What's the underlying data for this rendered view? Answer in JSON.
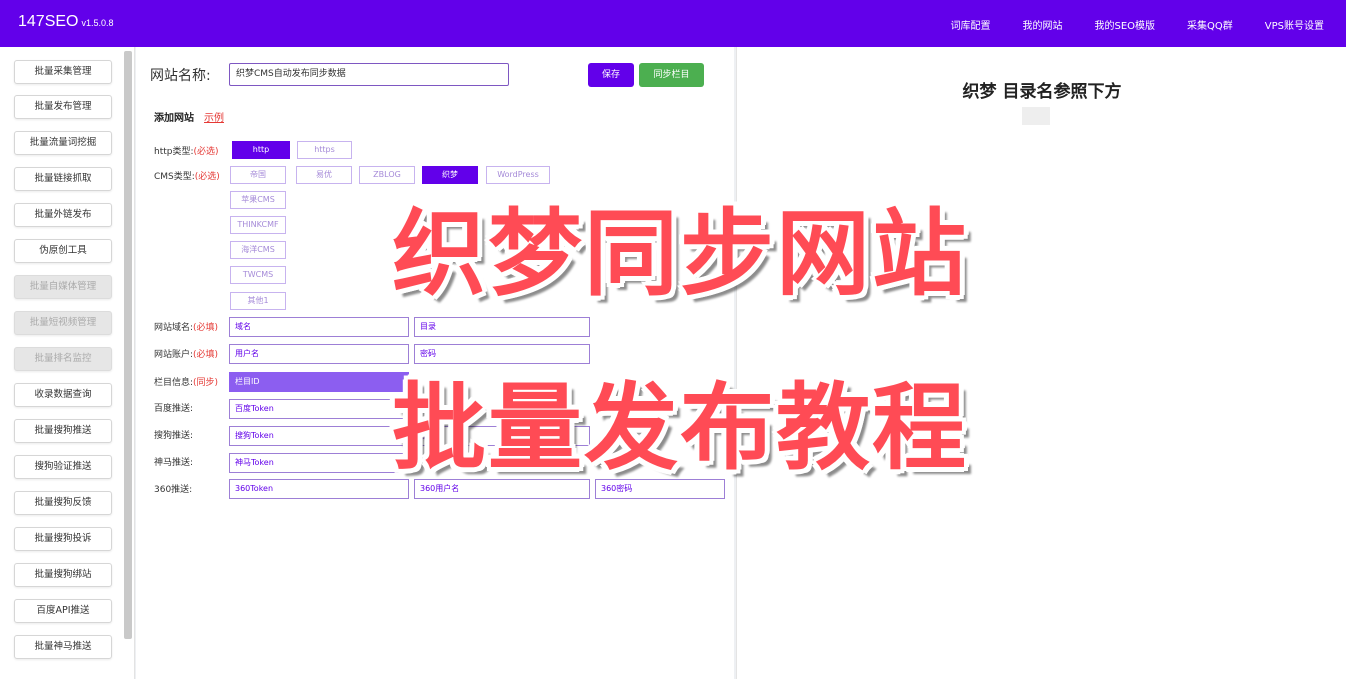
{
  "app": {
    "brand": "147SEO",
    "version": "v1.5.0.8"
  },
  "topnav": [
    "词库配置",
    "我的网站",
    "我的SEO模版",
    "采集QQ群",
    "VPS账号设置"
  ],
  "sidebar": [
    {
      "label": "批量采集管理",
      "disabled": false
    },
    {
      "label": "批量发布管理",
      "disabled": false
    },
    {
      "label": "批量流量词挖掘",
      "disabled": false
    },
    {
      "label": "批量链接抓取",
      "disabled": false
    },
    {
      "label": "批量外链发布",
      "disabled": false
    },
    {
      "label": "伪原创工具",
      "disabled": false
    },
    {
      "label": "批量自媒体管理",
      "disabled": true
    },
    {
      "label": "批量短视频管理",
      "disabled": true
    },
    {
      "label": "批量排名监控",
      "disabled": true
    },
    {
      "label": "收录数据查询",
      "disabled": false
    },
    {
      "label": "批量搜狗推送",
      "disabled": false
    },
    {
      "label": "搜狗验证推送",
      "disabled": false
    },
    {
      "label": "批量搜狗反馈",
      "disabled": false
    },
    {
      "label": "批量搜狗投诉",
      "disabled": false
    },
    {
      "label": "批量搜狗绑站",
      "disabled": false
    },
    {
      "label": "百度API推送",
      "disabled": false
    },
    {
      "label": "批量神马推送",
      "disabled": false
    }
  ],
  "form": {
    "site_name_label": "网站名称:",
    "site_name_value": "织梦CMS自动发布同步数据",
    "save_label": "保存",
    "sync_label": "同步栏目",
    "add_site_title": "添加网站",
    "add_site_example": "示例",
    "http_type_label": "http类型:",
    "required_mark": "(必选)",
    "http_options": [
      {
        "label": "http",
        "selected": true
      },
      {
        "label": "https",
        "selected": false
      }
    ],
    "cms_type_label": "CMS类型:",
    "cms_row1": [
      {
        "label": "帝国",
        "selected": false
      },
      {
        "label": "易优",
        "selected": false
      },
      {
        "label": "ZBLOG",
        "selected": false
      },
      {
        "label": "织梦",
        "selected": true
      },
      {
        "label": "WordPress",
        "selected": false
      }
    ],
    "cms_col": [
      "苹果CMS",
      "THINKCMF",
      "海洋CMS",
      "TWCMS",
      "其他1"
    ],
    "domain_label": "网站域名:",
    "domain_req": "(必填)",
    "domain_placeholder": "域名",
    "dir_placeholder": "目录",
    "account_label": "网站账户:",
    "account_req": "(必填)",
    "user_placeholder": "用户名",
    "pass_placeholder": "密码",
    "column_label": "栏目信息:",
    "column_req": "(同步)",
    "column_id": "栏目ID",
    "baidu_label": "百度推送:",
    "baidu_placeholder": "百度Token",
    "sogou_label": "搜狗推送:",
    "sogou_placeholder": "搜狗Token",
    "sogou_pass": "搜狗",
    "shenma_label": "神马推送:",
    "shenma_placeholder": "神马Token",
    "s360_label": "360推送:",
    "s360_placeholder": "360Token",
    "s360_user": "360用户名",
    "s360_pass": "360密码"
  },
  "right_panel": {
    "title": "织梦 目录名参照下方"
  },
  "overlay": {
    "line1": "织梦同步网站",
    "line2": "批量发布教程"
  },
  "colors": {
    "brand": "#6200ea",
    "green": "#4caf50",
    "overlay_red": "#ff4b55"
  }
}
